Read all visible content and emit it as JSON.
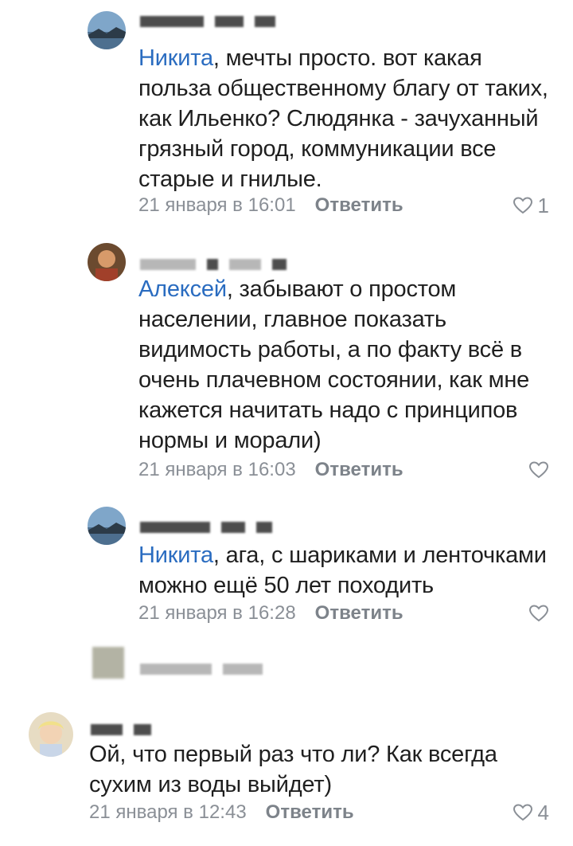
{
  "comments": [
    {
      "mention": "Никита",
      "text": ", мечты просто. вот какая польза общественному благу от таких, как Ильенко? Слюдянка - зачуханный грязный город, коммуникации все старые и гнилые.",
      "date": "21 января в 16:01",
      "reply_label": "Ответить",
      "likes": "1"
    },
    {
      "mention": "Алексей",
      "text": ", забывают о простом населении, главное показать видимость работы, а по факту всё в очень плачевном состоянии, как мне кажется начитать надо с принципов нормы и морали)",
      "date": "21 января в 16:03",
      "reply_label": "Ответить",
      "likes": ""
    },
    {
      "mention": "Никита",
      "text": ", ага, с шариками и ленточками можно ещё 50 лет походить",
      "date": "21 января в 16:28",
      "reply_label": "Ответить",
      "likes": ""
    },
    {
      "mention": "",
      "text": "Ой, что первый раз что ли? Как всегда сухим из воды выйдет)",
      "date": "21 января в 12:43",
      "reply_label": "Ответить",
      "likes": "4"
    }
  ],
  "icons": {
    "like": "heart-outline-icon"
  },
  "colors": {
    "mention": "#2a6cc0",
    "meta": "#8a8f96",
    "text": "#1f1f1f"
  }
}
